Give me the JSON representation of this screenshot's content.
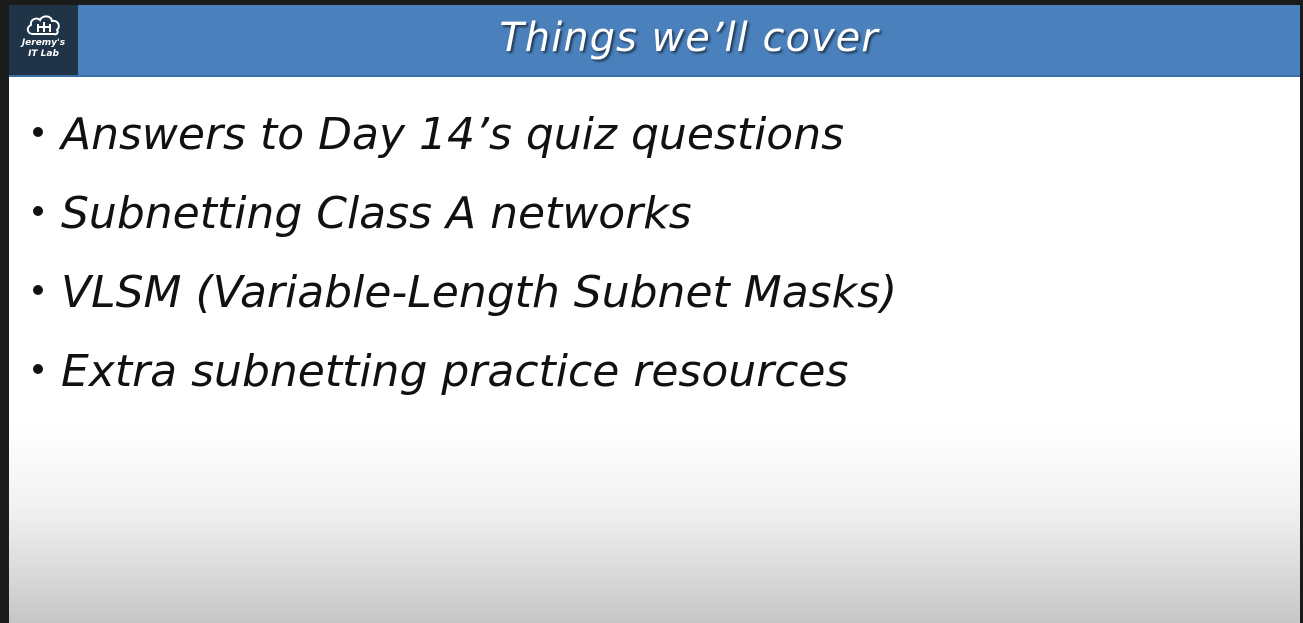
{
  "slide": {
    "title": "Things we’ll cover",
    "logo": {
      "icon": "cloud-network-icon",
      "line1": "Jeremy's",
      "line2": "IT Lab"
    },
    "bullets": [
      "Answers to Day 14’s quiz questions",
      "Subnetting Class A networks",
      "VLSM (Variable-Length Subnet Masks)",
      "Extra subnetting practice resources"
    ]
  },
  "colors": {
    "title_bar": "#4a80bc",
    "logo_bg": "#1f3447",
    "text": "#111111",
    "background": "#ffffff"
  }
}
